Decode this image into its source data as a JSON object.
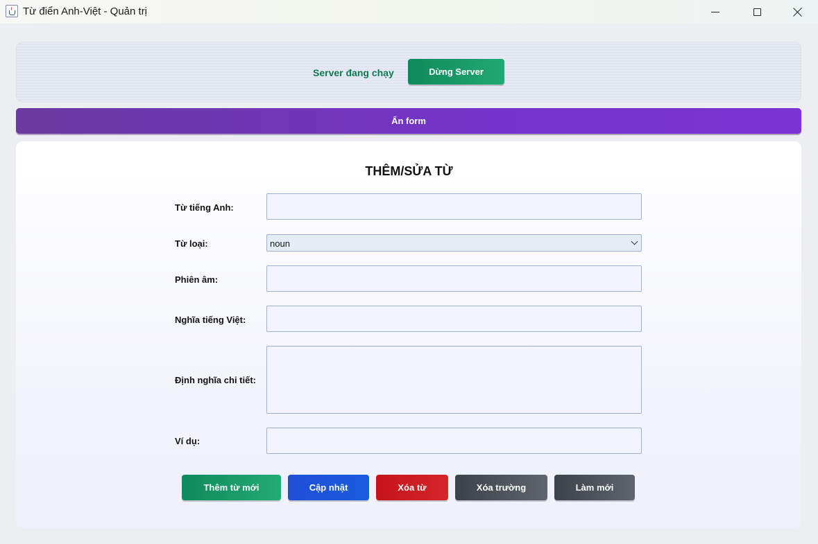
{
  "window": {
    "title": "Từ điển Anh-Việt - Quản trị"
  },
  "server": {
    "status_text": "Server đang chạy",
    "stop_label": "Dừng Server"
  },
  "toggle": {
    "label": "Ẩn form"
  },
  "form": {
    "title": "THÊM/SỬA TỪ",
    "fields": {
      "english_word": {
        "label": "Từ tiếng Anh:",
        "value": ""
      },
      "word_type": {
        "label": "Từ loại:",
        "value": "noun"
      },
      "phonetic": {
        "label": "Phiên âm:",
        "value": ""
      },
      "vietnamese_meaning": {
        "label": "Nghĩa tiếng Việt:",
        "value": ""
      },
      "definition": {
        "label": "Định nghĩa chi tiết:",
        "value": ""
      },
      "example": {
        "label": "Ví dụ:",
        "value": ""
      }
    },
    "buttons": {
      "add": "Thêm từ mới",
      "update": "Cập nhật",
      "delete": "Xóa từ",
      "clear": "Xóa trường",
      "refresh": "Làm mới"
    }
  },
  "colors": {
    "green": "#0e8a5c",
    "purple": "#7434c9",
    "blue": "#1f4fd6",
    "red": "#c5141a",
    "gray": "#4a4e55"
  },
  "icons": {
    "app": "java-coffee-cup-icon",
    "minimize": "minimize-icon",
    "maximize": "maximize-icon",
    "close": "close-icon",
    "select_arrow": "chevron-down-icon"
  }
}
